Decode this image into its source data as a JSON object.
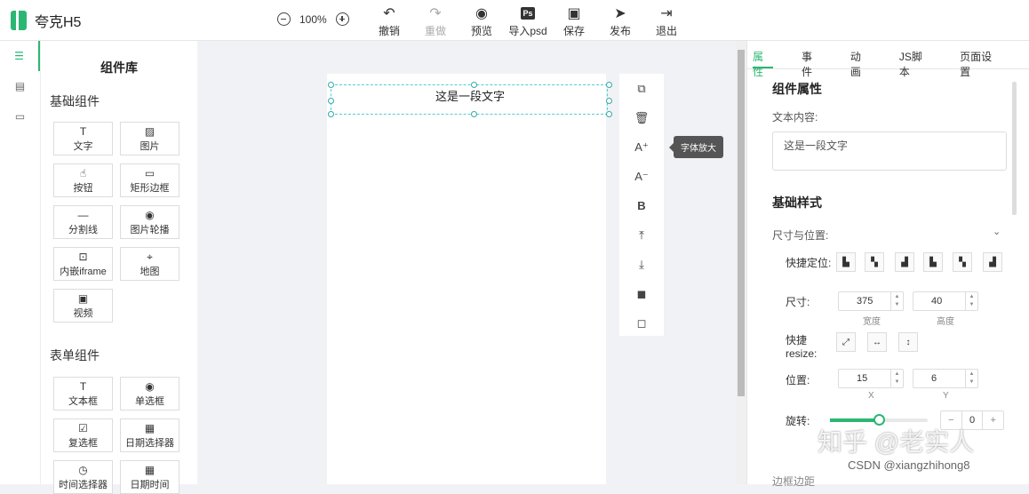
{
  "app": {
    "title": "夸克H5"
  },
  "zoom": {
    "value": "100%"
  },
  "toolbar": [
    {
      "label": "撤销",
      "icon": "undo-icon",
      "disabled": false
    },
    {
      "label": "重做",
      "icon": "redo-icon",
      "disabled": true
    },
    {
      "label": "预览",
      "icon": "eye-icon",
      "disabled": false
    },
    {
      "label": "导入psd",
      "icon": "ps-icon",
      "disabled": false
    },
    {
      "label": "保存",
      "icon": "save-icon",
      "disabled": false
    },
    {
      "label": "发布",
      "icon": "send-icon",
      "disabled": false
    },
    {
      "label": "退出",
      "icon": "exit-icon",
      "disabled": false
    }
  ],
  "library": {
    "title": "组件库",
    "basic_title": "基础组件",
    "basic": [
      {
        "label": "文字",
        "icon": "T"
      },
      {
        "label": "图片",
        "icon": "▨"
      },
      {
        "label": "按钮",
        "icon": "☝"
      },
      {
        "label": "矩形边框",
        "icon": "▭"
      },
      {
        "label": "分割线",
        "icon": "—"
      },
      {
        "label": "图片轮播",
        "icon": "◉"
      },
      {
        "label": "内嵌iframe",
        "icon": "⊡"
      },
      {
        "label": "地图",
        "icon": "⌖"
      },
      {
        "label": "视频",
        "icon": "▣"
      }
    ],
    "form_title": "表单组件",
    "form": [
      {
        "label": "文本框",
        "icon": "T"
      },
      {
        "label": "单选框",
        "icon": "◉"
      },
      {
        "label": "复选框",
        "icon": "☑"
      },
      {
        "label": "日期选择器",
        "icon": "▦"
      },
      {
        "label": "时间选择器",
        "icon": "◷"
      },
      {
        "label": "日期时间",
        "icon": "▦"
      }
    ]
  },
  "canvas": {
    "text": "这是一段文字"
  },
  "tooltip": "字体放大",
  "panel": {
    "tabs": [
      "属性",
      "事件",
      "动画",
      "JS脚本",
      "页面设置"
    ],
    "component_props": "组件属性",
    "text_content_label": "文本内容:",
    "text_content_value": "这是一段文字",
    "basic_style": "基础样式",
    "size_pos": "尺寸与位置:",
    "quick_pos": "快捷定位:",
    "size_label": "尺寸:",
    "width": "375",
    "width_label": "宽度",
    "height": "40",
    "height_label": "高度",
    "quick_resize": "快捷",
    "quick_resize2": "resize:",
    "pos_label": "位置:",
    "x": "15",
    "x_label": "X",
    "y": "6",
    "y_label": "Y",
    "rotate_label": "旋转:",
    "rotate_value": "0",
    "rotate_fraction": 0.5,
    "cut_off": "边框边距"
  },
  "watermark": "知乎 @老实人",
  "csdn": "CSDN @xiangzhihong8"
}
